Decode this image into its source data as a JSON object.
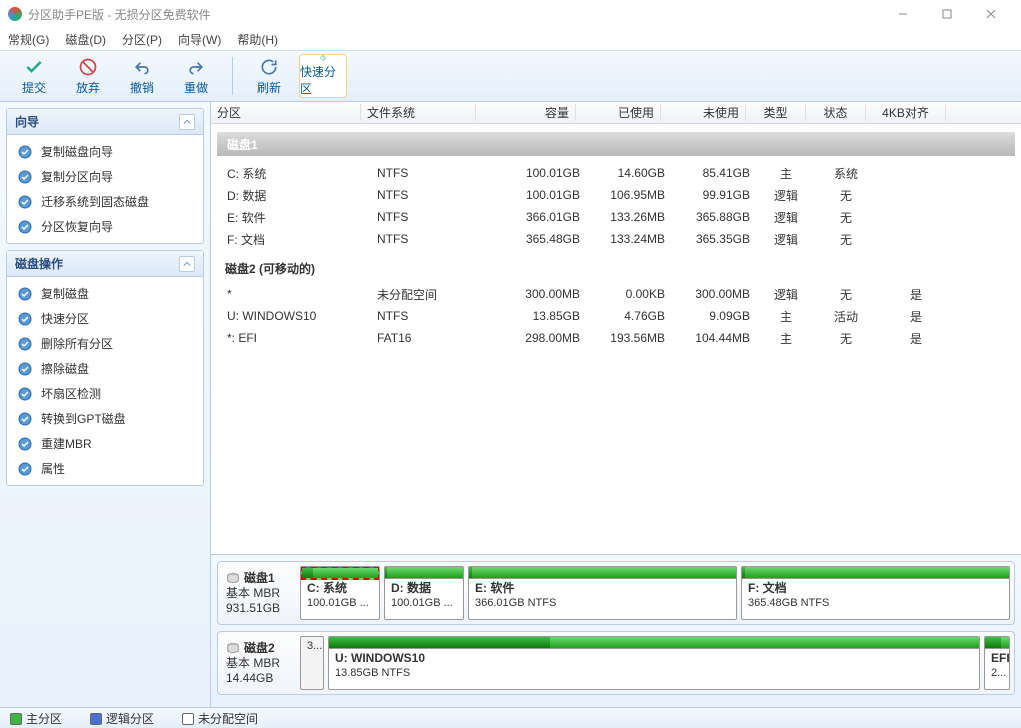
{
  "title": "分区助手PE版 - 无损分区免费软件",
  "menu": [
    "常规(G)",
    "磁盘(D)",
    "分区(P)",
    "向导(W)",
    "帮助(H)"
  ],
  "toolbar": {
    "commit": "提交",
    "discard": "放弃",
    "undo": "撤销",
    "redo": "重做",
    "refresh": "刷新",
    "quick": "快速分区"
  },
  "panels": {
    "wizard": {
      "title": "向导",
      "items": [
        "复制磁盘向导",
        "复制分区向导",
        "迁移系统到固态磁盘",
        "分区恢复向导"
      ]
    },
    "diskops": {
      "title": "磁盘操作",
      "items": [
        "复制磁盘",
        "快速分区",
        "删除所有分区",
        "擦除磁盘",
        "坏扇区检测",
        "转换到GPT磁盘",
        "重建MBR",
        "属性"
      ]
    }
  },
  "columns": {
    "part": "分区",
    "fs": "文件系统",
    "cap": "容量",
    "used": "已使用",
    "free": "未使用",
    "type": "类型",
    "state": "状态",
    "align": "4KB对齐"
  },
  "disk1": {
    "header": "磁盘1",
    "rows": [
      {
        "part": "C: 系统",
        "fs": "NTFS",
        "cap": "100.01GB",
        "used": "14.60GB",
        "free": "85.41GB",
        "type": "主",
        "state": "系统",
        "align": ""
      },
      {
        "part": "D: 数据",
        "fs": "NTFS",
        "cap": "100.01GB",
        "used": "106.95MB",
        "free": "99.91GB",
        "type": "逻辑",
        "state": "无",
        "align": ""
      },
      {
        "part": "E: 软件",
        "fs": "NTFS",
        "cap": "366.01GB",
        "used": "133.26MB",
        "free": "365.88GB",
        "type": "逻辑",
        "state": "无",
        "align": ""
      },
      {
        "part": "F: 文档",
        "fs": "NTFS",
        "cap": "365.48GB",
        "used": "133.24MB",
        "free": "365.35GB",
        "type": "逻辑",
        "state": "无",
        "align": ""
      }
    ]
  },
  "disk2": {
    "header": "磁盘2 (可移动的)",
    "rows": [
      {
        "part": "*",
        "fs": "未分配空间",
        "cap": "300.00MB",
        "used": "0.00KB",
        "free": "300.00MB",
        "type": "逻辑",
        "state": "无",
        "align": "是"
      },
      {
        "part": "U: WINDOWS10",
        "fs": "NTFS",
        "cap": "13.85GB",
        "used": "4.76GB",
        "free": "9.09GB",
        "type": "主",
        "state": "活动",
        "align": "是"
      },
      {
        "part": "*: EFI",
        "fs": "FAT16",
        "cap": "298.00MB",
        "used": "193.56MB",
        "free": "104.44MB",
        "type": "主",
        "state": "无",
        "align": "是"
      }
    ]
  },
  "map": {
    "d1": {
      "name": "磁盘1",
      "scheme": "基本 MBR",
      "size": "931.51GB",
      "parts": [
        {
          "label": "C: 系统",
          "sub": "100.01GB ..."
        },
        {
          "label": "D: 数据",
          "sub": "100.01GB ..."
        },
        {
          "label": "E: 软件",
          "sub": "366.01GB NTFS"
        },
        {
          "label": "F: 文档",
          "sub": "365.48GB NTFS"
        }
      ]
    },
    "d2": {
      "name": "磁盘2",
      "scheme": "基本 MBR",
      "size": "14.44GB",
      "un": "3...",
      "parts": [
        {
          "label": "U: WINDOWS10",
          "sub": "13.85GB NTFS"
        },
        {
          "label": "EFI",
          "sub": "2..."
        }
      ]
    }
  },
  "legend": {
    "primary": "主分区",
    "logical": "逻辑分区",
    "unalloc": "未分配空间"
  }
}
